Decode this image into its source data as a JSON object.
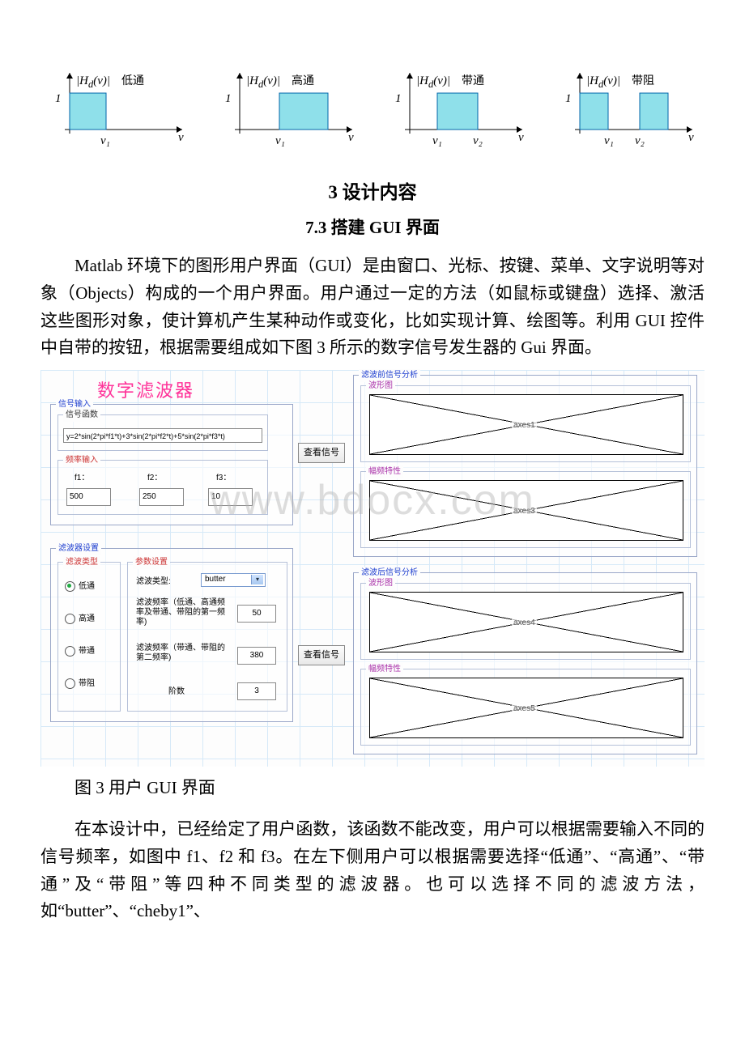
{
  "filters": {
    "hd": "|H_d(v)|",
    "types": [
      "低通",
      "高通",
      "带通",
      "带阻"
    ],
    "ticks": {
      "one": "1",
      "v": "v",
      "v1": "v₁",
      "v2": "v₂"
    }
  },
  "section": {
    "title": "3 设计内容",
    "subtitle": "7.3 搭建 GUI 界面"
  },
  "para1": "Matlab 环境下的图形用户界面（GUI）是由窗口、光标、按键、菜单、文字说明等对象（Objects）构成的一个用户界面。用户通过一定的方法（如鼠标或键盘）选择、激活这些图形对象，使计算机产生某种动作或变化，比如实现计算、绘图等。利用 GUI 控件中自带的按钮，根据需要组成如下图 3 所示的数字信号发生器的 Gui 界面。",
  "gui": {
    "watermark": "www.bdocx.com",
    "title": "数字滤波器",
    "signal_input": {
      "panel": "信号输入",
      "func_panel": "信号函数",
      "func_value": "y=2*sin(2*pi*f1*t)+3*sin(2*pi*f2*t)+5*sin(2*pi*f3*t)",
      "freq_panel": "频率输入",
      "f1_label": "f1：",
      "f1": "500",
      "f2_label": "f2：",
      "f2": "250",
      "f3_label": "f3：",
      "f3": "10",
      "view_btn": "查看信号"
    },
    "filter_set": {
      "panel": "滤波器设置",
      "type_panel": "滤波类型",
      "types": [
        "低通",
        "高通",
        "带通",
        "带阻"
      ],
      "selected": 0,
      "param_panel": "参数设置",
      "method_label": "滤波类型:",
      "method_value": "butter",
      "freq1_label": "滤波频率（低通、高通频率及带通、带阻的第一频率)",
      "freq1": "50",
      "freq2_label": "滤波频率（带通、带阻的第二频率)",
      "freq2": "380",
      "order_label": "阶数",
      "order": "3",
      "view_btn": "查看信号"
    },
    "pre": {
      "panel": "滤波前信号分析",
      "wave": "波形图",
      "mag": "幅频特性",
      "axes1": "axes1",
      "axes3": "axes3"
    },
    "post": {
      "panel": "滤波后信号分析",
      "wave": "波形图",
      "mag": "幅频特性",
      "axes4": "axes4",
      "axes5": "axes5"
    }
  },
  "fig_caption": "图 3 用户 GUI 界面",
  "para2": "在本设计中，已经给定了用户函数，该函数不能改变，用户可以根据需要输入不同的信号频率，如图中 f1、f2 和 f3。在左下侧用户可以根据需要选择“低通”、“高通”、“带通”及“带阻”等四种不同类型的滤波器。也可以选择不同的滤波方法，如“butter”、“cheby1”、"
}
